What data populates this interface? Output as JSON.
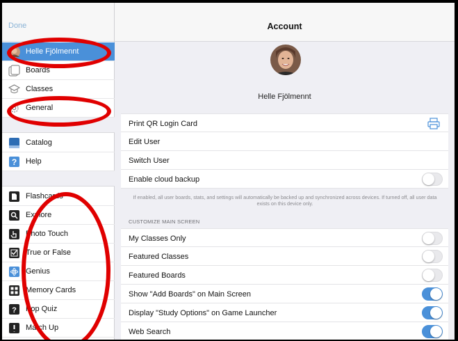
{
  "sidebar": {
    "done_label": "Done",
    "account_items": [
      {
        "label": "Helle Fjölmennt",
        "icon": "user-avatar-icon"
      },
      {
        "label": "Boards",
        "icon": "boards-icon"
      },
      {
        "label": "Classes",
        "icon": "classes-icon"
      },
      {
        "label": "General",
        "icon": "gear-icon"
      }
    ],
    "info_items": [
      {
        "label": "Catalog",
        "icon": "book-icon"
      },
      {
        "label": "Help",
        "icon": "help-icon"
      }
    ],
    "game_items": [
      {
        "label": "Flashcards",
        "icon": "flashcards-icon"
      },
      {
        "label": "Explore",
        "icon": "explore-icon"
      },
      {
        "label": "Photo Touch",
        "icon": "photo-touch-icon"
      },
      {
        "label": "True or False",
        "icon": "checkbox-icon"
      },
      {
        "label": "Genius",
        "icon": "atom-icon"
      },
      {
        "label": "Memory Cards",
        "icon": "memory-cards-icon"
      },
      {
        "label": "Pop Quiz",
        "icon": "pop-quiz-icon"
      },
      {
        "label": "Match Up",
        "icon": "match-up-icon"
      }
    ]
  },
  "main": {
    "title": "Account",
    "user_name": "Helle Fjölmennt",
    "rows_top": [
      {
        "label": "Print QR Login Card",
        "accessory": "printer-icon"
      },
      {
        "label": "Edit User"
      },
      {
        "label": "Switch User"
      },
      {
        "label": "Enable cloud backup",
        "toggle": false
      }
    ],
    "cloud_note": "If enabled, all user boards, stats, and settings will automatically be backed up and synchronized across devices. If turned off, all user data exists on this device only.",
    "section_header": "CUSTOMIZE MAIN SCREEN",
    "rows_custom": [
      {
        "label": "My Classes Only",
        "toggle": false
      },
      {
        "label": "Featured Classes",
        "toggle": false
      },
      {
        "label": "Featured Boards",
        "toggle": false
      },
      {
        "label": "Show \"Add Boards\" on Main Screen",
        "toggle": true
      },
      {
        "label": "Display \"Study Options\" on Game Launcher",
        "toggle": true
      },
      {
        "label": "Web Search",
        "toggle": true
      }
    ]
  },
  "colors": {
    "accent": "#4a90d9",
    "annotation": "#e00000"
  }
}
